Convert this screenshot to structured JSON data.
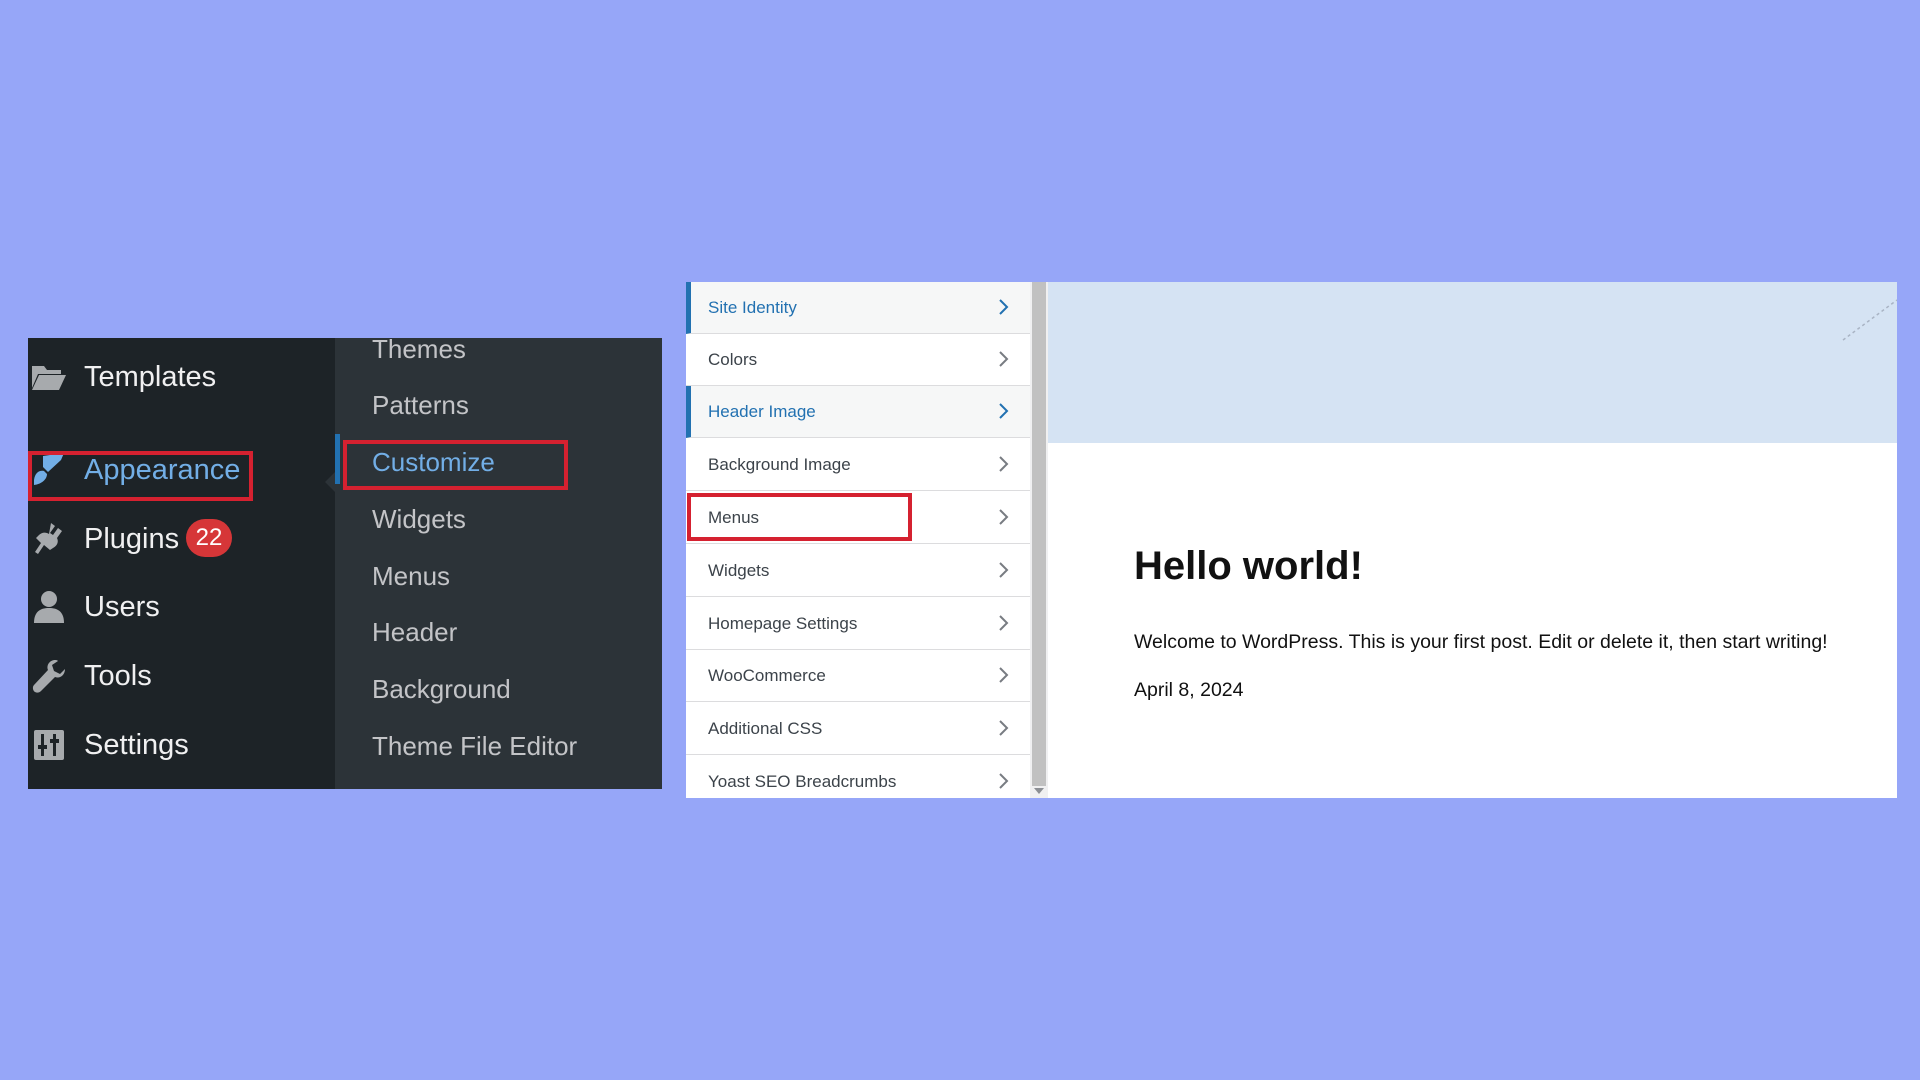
{
  "admin_menu": {
    "items": [
      {
        "label": "Templates",
        "icon": "folder-icon"
      },
      {
        "label": "Appearance",
        "icon": "paintbrush-icon"
      },
      {
        "label": "Plugins",
        "icon": "plugin-icon",
        "badge": "22"
      },
      {
        "label": "Users",
        "icon": "user-icon"
      },
      {
        "label": "Tools",
        "icon": "wrench-icon"
      },
      {
        "label": "Settings",
        "icon": "settings-icon"
      }
    ],
    "submenu": [
      "Themes",
      "Patterns",
      "Customize",
      "Widgets",
      "Menus",
      "Header",
      "Background",
      "Theme File Editor"
    ]
  },
  "customizer": {
    "panels": [
      "Site Identity",
      "Colors",
      "Header Image",
      "Background Image",
      "Menus",
      "Widgets",
      "Homepage Settings",
      "WooCommerce",
      "Additional CSS",
      "Yoast SEO Breadcrumbs"
    ]
  },
  "preview": {
    "post_title": "Hello world!",
    "post_body": "Welcome to WordPress. This is your first post. Edit or delete it, then start writing!",
    "post_date": "April 8, 2024"
  },
  "colors": {
    "background": "#96a6f8",
    "admin_bg": "#1d2327",
    "submenu_bg": "#2c3338",
    "accent": "#72aee6",
    "highlight_box": "#d52130",
    "badge": "#d63638"
  }
}
